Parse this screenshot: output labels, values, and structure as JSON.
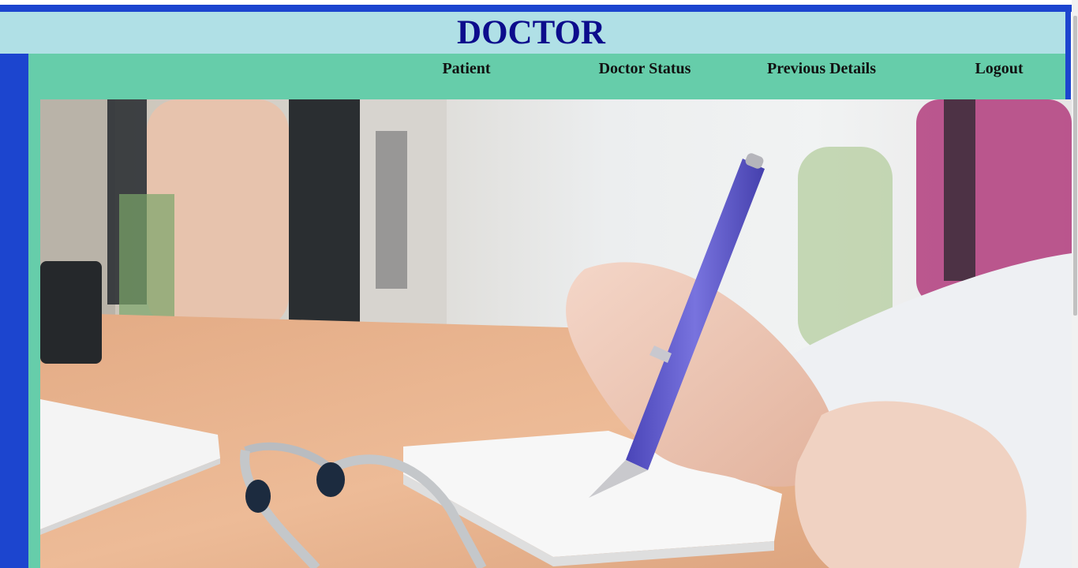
{
  "header": {
    "title": "DOCTOR"
  },
  "nav": {
    "items": [
      {
        "label": "Patient"
      },
      {
        "label": "Doctor Status"
      },
      {
        "label": "Previous Details"
      },
      {
        "label": "Logout"
      }
    ]
  },
  "colors": {
    "frame_blue": "#1c45cf",
    "header_bg": "#b0e0e6",
    "title_color": "#0c0c8c",
    "nav_bg": "#66cdaa"
  },
  "hero": {
    "subject": "doctor-writing-with-pen-and-stethoscope"
  }
}
